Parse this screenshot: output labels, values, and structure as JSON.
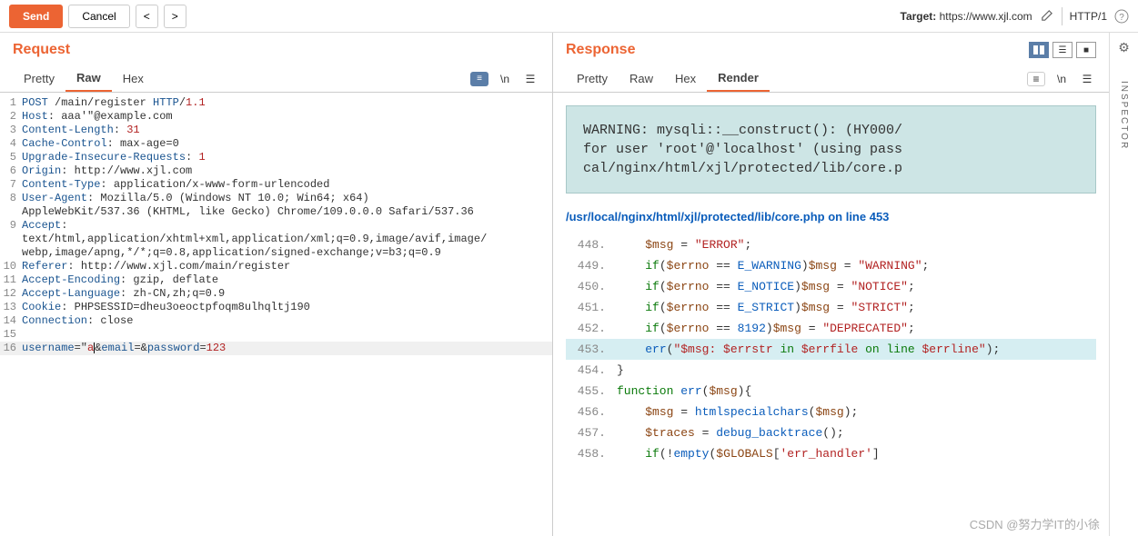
{
  "toolbar": {
    "send": "Send",
    "cancel": "Cancel",
    "target_label": "Target: ",
    "target_url": "https://www.xjl.com",
    "http_version": "HTTP/1"
  },
  "request": {
    "title": "Request",
    "tabs": [
      "Pretty",
      "Raw",
      "Hex"
    ],
    "active_tab": "Raw",
    "lines": [
      {
        "n": 1,
        "segs": [
          [
            "kw",
            "POST"
          ],
          [
            "",
            " /main/register "
          ],
          [
            "kw",
            "HTTP"
          ],
          [
            "",
            "/"
          ],
          [
            "num",
            "1.1"
          ]
        ]
      },
      {
        "n": 2,
        "segs": [
          [
            "kw",
            "Host"
          ],
          [
            "",
            ": aaa'\"@example.com"
          ]
        ]
      },
      {
        "n": 3,
        "segs": [
          [
            "kw",
            "Content-Length"
          ],
          [
            "",
            ": "
          ],
          [
            "num",
            "31"
          ]
        ]
      },
      {
        "n": 4,
        "segs": [
          [
            "kw",
            "Cache-Control"
          ],
          [
            "",
            ": max-age=0"
          ]
        ]
      },
      {
        "n": 5,
        "segs": [
          [
            "kw",
            "Upgrade-Insecure-Requests"
          ],
          [
            "",
            ": "
          ],
          [
            "num",
            "1"
          ]
        ]
      },
      {
        "n": 6,
        "segs": [
          [
            "kw",
            "Origin"
          ],
          [
            "",
            ": http://www.xjl.com"
          ]
        ]
      },
      {
        "n": 7,
        "segs": [
          [
            "kw",
            "Content-Type"
          ],
          [
            "",
            ": application/x-www-form-urlencoded"
          ]
        ]
      },
      {
        "n": 8,
        "segs": [
          [
            "kw",
            "User-Agent"
          ],
          [
            "",
            ": Mozilla/5.0 (Windows NT 10.0; Win64; x64)"
          ]
        ]
      },
      {
        "n": 0,
        "segs": [
          [
            "",
            "AppleWebKit/537.36 (KHTML, like Gecko) Chrome/109.0.0.0 Safari/537.36"
          ]
        ]
      },
      {
        "n": 9,
        "segs": [
          [
            "kw",
            "Accept"
          ],
          [
            "",
            ":"
          ]
        ]
      },
      {
        "n": 0,
        "segs": [
          [
            "",
            "text/html,application/xhtml+xml,application/xml;q=0.9,image/avif,image/"
          ]
        ]
      },
      {
        "n": 0,
        "segs": [
          [
            "",
            "webp,image/apng,*/*;q=0.8,application/signed-exchange;v=b3;q=0.9"
          ]
        ]
      },
      {
        "n": 10,
        "segs": [
          [
            "kw",
            "Referer"
          ],
          [
            "",
            ": http://www.xjl.com/main/register"
          ]
        ]
      },
      {
        "n": 11,
        "segs": [
          [
            "kw",
            "Accept-Encoding"
          ],
          [
            "",
            ": gzip, deflate"
          ]
        ]
      },
      {
        "n": 12,
        "segs": [
          [
            "kw",
            "Accept-Language"
          ],
          [
            "",
            ": zh-CN,zh;q=0.9"
          ]
        ]
      },
      {
        "n": 13,
        "segs": [
          [
            "kw",
            "Cookie"
          ],
          [
            "",
            ": PHPSESSID=dheu3oeoctpfoqm8ulhqltj190"
          ]
        ]
      },
      {
        "n": 14,
        "segs": [
          [
            "kw",
            "Connection"
          ],
          [
            "",
            ": close"
          ]
        ]
      },
      {
        "n": 15,
        "segs": [
          [
            "",
            ""
          ]
        ]
      },
      {
        "n": 16,
        "hl": true,
        "segs": [
          [
            "kw",
            "username"
          ],
          [
            "",
            "=\""
          ],
          [
            "str",
            "a"
          ],
          [
            "cursor",
            ""
          ],
          [
            "",
            "&"
          ],
          [
            "kw",
            "email"
          ],
          [
            "",
            "=&"
          ],
          [
            "kw",
            "password"
          ],
          [
            "",
            "="
          ],
          [
            "num",
            "123"
          ]
        ]
      }
    ]
  },
  "response": {
    "title": "Response",
    "tabs": [
      "Pretty",
      "Raw",
      "Hex",
      "Render"
    ],
    "active_tab": "Render",
    "warning_text": "WARNING: mysqli::__construct(): (HY000/\nfor user 'root'@'localhost' (using pass\ncal/nginx/html/xjl/protected/lib/core.p",
    "path": "/usr/local/nginx/html/xjl/protected/lib/core.php on line 453",
    "code": [
      {
        "n": "448.",
        "segs": [
          [
            "",
            "    "
          ],
          [
            "php-var",
            "$msg"
          ],
          [
            "",
            " = "
          ],
          [
            "php-str",
            "\"ERROR\""
          ],
          [
            "",
            ";"
          ]
        ]
      },
      {
        "n": "449.",
        "segs": [
          [
            "",
            "    "
          ],
          [
            "php-kw",
            "if"
          ],
          [
            "",
            "("
          ],
          [
            "php-var",
            "$errno"
          ],
          [
            "",
            " == "
          ],
          [
            "php-const",
            "E_WARNING"
          ],
          [
            "",
            ")"
          ],
          [
            "php-var",
            "$msg"
          ],
          [
            "",
            " = "
          ],
          [
            "php-str",
            "\"WARNING\""
          ],
          [
            "",
            ";"
          ]
        ]
      },
      {
        "n": "450.",
        "segs": [
          [
            "",
            "    "
          ],
          [
            "php-kw",
            "if"
          ],
          [
            "",
            "("
          ],
          [
            "php-var",
            "$errno"
          ],
          [
            "",
            " == "
          ],
          [
            "php-const",
            "E_NOTICE"
          ],
          [
            "",
            ")"
          ],
          [
            "php-var",
            "$msg"
          ],
          [
            "",
            " = "
          ],
          [
            "php-str",
            "\"NOTICE\""
          ],
          [
            "",
            ";"
          ]
        ]
      },
      {
        "n": "451.",
        "segs": [
          [
            "",
            "    "
          ],
          [
            "php-kw",
            "if"
          ],
          [
            "",
            "("
          ],
          [
            "php-var",
            "$errno"
          ],
          [
            "",
            " == "
          ],
          [
            "php-const",
            "E_STRICT"
          ],
          [
            "",
            ")"
          ],
          [
            "php-var",
            "$msg"
          ],
          [
            "",
            " = "
          ],
          [
            "php-str",
            "\"STRICT\""
          ],
          [
            "",
            ";"
          ]
        ]
      },
      {
        "n": "452.",
        "segs": [
          [
            "",
            "    "
          ],
          [
            "php-kw",
            "if"
          ],
          [
            "",
            "("
          ],
          [
            "php-var",
            "$errno"
          ],
          [
            "",
            " == "
          ],
          [
            "php-const",
            "8192"
          ],
          [
            "",
            ")"
          ],
          [
            "php-var",
            "$msg"
          ],
          [
            "",
            " = "
          ],
          [
            "php-str",
            "\"DEPRECATED\""
          ],
          [
            "",
            ";"
          ]
        ]
      },
      {
        "n": "453.",
        "hl": true,
        "segs": [
          [
            "",
            "    "
          ],
          [
            "php-func",
            "err"
          ],
          [
            "",
            "("
          ],
          [
            "php-str",
            "\"$msg: $errstr "
          ],
          [
            "php-kw",
            "in"
          ],
          [
            "php-str",
            " $errfile "
          ],
          [
            "php-kw",
            "on line"
          ],
          [
            "php-str",
            " $errline\""
          ],
          [
            "",
            ");"
          ]
        ]
      },
      {
        "n": "454.",
        "segs": [
          [
            "",
            "}"
          ]
        ]
      },
      {
        "n": "455.",
        "segs": [
          [
            "php-kw",
            "function"
          ],
          [
            "",
            " "
          ],
          [
            "php-func",
            "err"
          ],
          [
            "",
            "("
          ],
          [
            "php-var",
            "$msg"
          ],
          [
            "",
            "){"
          ]
        ]
      },
      {
        "n": "456.",
        "segs": [
          [
            "",
            "    "
          ],
          [
            "php-var",
            "$msg"
          ],
          [
            "",
            " = "
          ],
          [
            "php-func",
            "htmlspecialchars"
          ],
          [
            "",
            "("
          ],
          [
            "php-var",
            "$msg"
          ],
          [
            "",
            ");"
          ]
        ]
      },
      {
        "n": "457.",
        "segs": [
          [
            "",
            "    "
          ],
          [
            "php-var",
            "$traces"
          ],
          [
            "",
            " = "
          ],
          [
            "php-func",
            "debug_backtrace"
          ],
          [
            "",
            "();"
          ]
        ]
      },
      {
        "n": "458.",
        "segs": [
          [
            "",
            "    "
          ],
          [
            "php-kw",
            "if"
          ],
          [
            "",
            "(!"
          ],
          [
            "php-func",
            "empty"
          ],
          [
            "",
            "("
          ],
          [
            "php-var",
            "$GLOBALS"
          ],
          [
            "",
            "["
          ],
          [
            "php-str",
            "'err_handler'"
          ],
          [
            "",
            "]"
          ]
        ]
      }
    ]
  },
  "side": {
    "inspector": "INSPECTOR"
  },
  "watermark": "CSDN @努力学IT的小徐"
}
